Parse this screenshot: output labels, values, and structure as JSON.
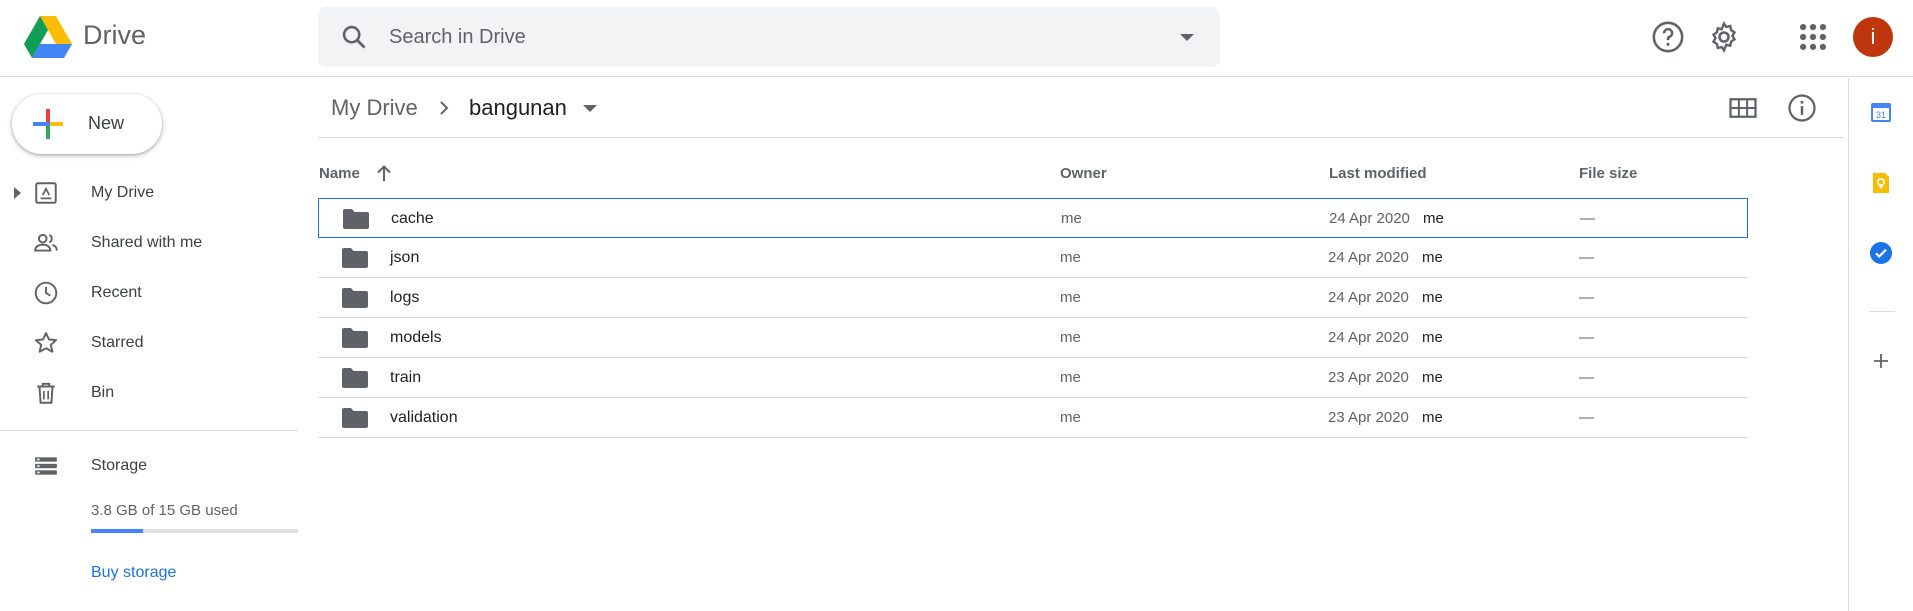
{
  "app": {
    "name": "Drive"
  },
  "search": {
    "placeholder": "Search in Drive"
  },
  "header": {
    "icons": [
      "help-icon",
      "settings-icon",
      "apps-grid-icon"
    ],
    "avatar_letter": "i",
    "avatar_color": "#bf360c"
  },
  "sidebar": {
    "new_label": "New",
    "items": [
      {
        "label": "My Drive",
        "icon": "my-drive-icon"
      },
      {
        "label": "Shared with me",
        "icon": "shared-icon"
      },
      {
        "label": "Recent",
        "icon": "clock-icon"
      },
      {
        "label": "Starred",
        "icon": "star-icon"
      },
      {
        "label": "Bin",
        "icon": "trash-icon"
      }
    ],
    "storage": {
      "label": "Storage",
      "used_text": "3.8 GB of 15 GB used",
      "used_fraction": 0.253,
      "buy_label": "Buy storage"
    }
  },
  "breadcrumb": {
    "root": "My Drive",
    "current": "bangunan"
  },
  "columns": {
    "name": "Name",
    "owner": "Owner",
    "modified": "Last modified",
    "size": "File size"
  },
  "files": [
    {
      "name": "cache",
      "owner": "me",
      "date": "24 Apr 2020",
      "by": "me",
      "size": "—"
    },
    {
      "name": "json",
      "owner": "me",
      "date": "24 Apr 2020",
      "by": "me",
      "size": "—"
    },
    {
      "name": "logs",
      "owner": "me",
      "date": "24 Apr 2020",
      "by": "me",
      "size": "—"
    },
    {
      "name": "models",
      "owner": "me",
      "date": "24 Apr 2020",
      "by": "me",
      "size": "—"
    },
    {
      "name": "train",
      "owner": "me",
      "date": "23 Apr 2020",
      "by": "me",
      "size": "—"
    },
    {
      "name": "validation",
      "owner": "me",
      "date": "23 Apr 2020",
      "by": "me",
      "size": "—"
    }
  ],
  "side_panel": {
    "calendar_date": "31",
    "icons": [
      "calendar-icon",
      "keep-icon",
      "tasks-icon",
      "add-addon-icon"
    ]
  },
  "colors": {
    "accent": "#1a73e8",
    "folder": "#5f6368"
  }
}
